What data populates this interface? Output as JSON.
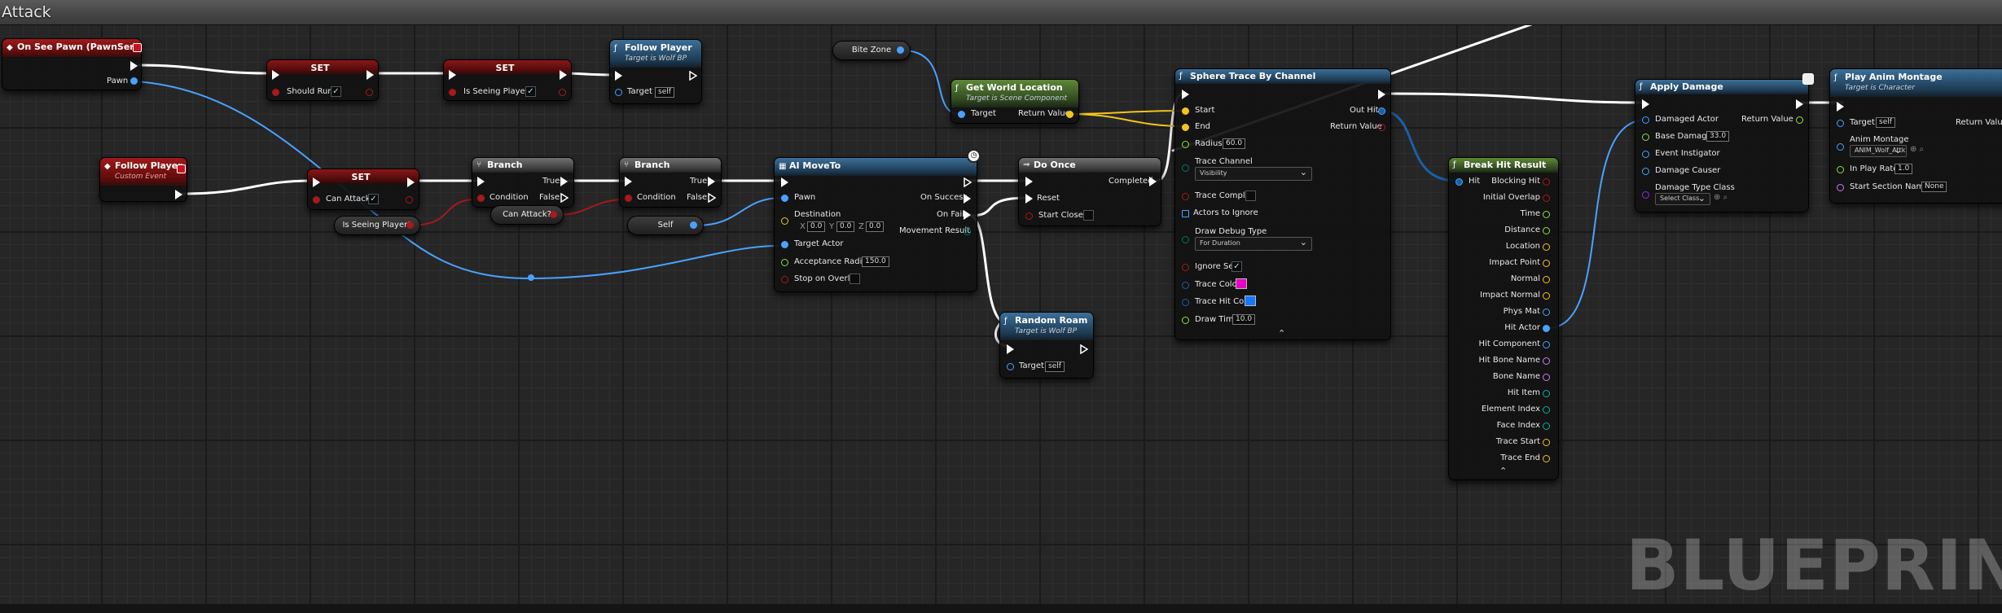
{
  "graph": {
    "title": "Attack",
    "watermark": "BLUEPRINT"
  },
  "colors": {
    "exec": "#ffffff",
    "object": "#4aa1ff",
    "bool": "#a51a1a",
    "float": "#8ce23c",
    "vector": "#f2c41f",
    "struct": "#1a5fa8",
    "byte": "#00756b",
    "name": "#c77ef3",
    "string": "#e55ad9"
  },
  "nodes": {
    "on_see_pawn": {
      "title": "On See Pawn (PawnSensing)",
      "pawn": "Pawn"
    },
    "set_should_run": {
      "title": "SET",
      "var": "Should Run?",
      "checked": "✓"
    },
    "set_is_seeing": {
      "title": "SET",
      "var": "Is Seeing Player?",
      "checked": "✓"
    },
    "follow_player_call": {
      "title": "Follow Player",
      "subtitle": "Target is Wolf BP",
      "target": "Target",
      "target_value": "self"
    },
    "follow_player_event": {
      "title": "Follow Player",
      "subtitle": "Custom Event"
    },
    "set_can_attack": {
      "title": "SET",
      "var": "Can Attack?",
      "checked": "✓"
    },
    "branch1": {
      "title": "Branch",
      "condition": "Condition",
      "true": "True",
      "false": "False"
    },
    "branch2": {
      "title": "Branch",
      "condition": "Condition",
      "true": "True",
      "false": "False"
    },
    "get_is_seeing": {
      "label": "Is Seeing Player?"
    },
    "get_can_attack": {
      "label": "Can Attack?"
    },
    "self_ref": {
      "label": "Self"
    },
    "bite_zone": {
      "label": "Bite Zone"
    },
    "get_world_location": {
      "title": "Get World Location",
      "subtitle": "Target is Scene Component",
      "target": "Target",
      "return": "Return Value"
    },
    "ai_move_to": {
      "title": "AI MoveTo",
      "pawn": "Pawn",
      "destination": "Destination",
      "x_lbl": "X",
      "x": "0.0",
      "y_lbl": "Y",
      "y": "0.0",
      "z_lbl": "Z",
      "z": "0.0",
      "target_actor": "Target Actor",
      "acceptance": "Acceptance Radius",
      "acceptance_value": "150.0",
      "stop_overlap": "Stop on Overlap",
      "on_success": "On Success",
      "on_fail": "On Fail",
      "move_result": "Movement Result"
    },
    "do_once": {
      "title": "Do Once",
      "completed": "Completed",
      "reset": "Reset",
      "start_closed": "Start Closed"
    },
    "random_roam": {
      "title": "Random Roam",
      "subtitle": "Target is Wolf BP",
      "target": "Target",
      "target_value": "self"
    },
    "sphere_trace": {
      "title": "Sphere Trace By Channel",
      "start": "Start",
      "end": "End",
      "radius": "Radius",
      "radius_value": "60.0",
      "trace_channel": "Trace Channel",
      "trace_channel_value": "Visibility",
      "trace_complex": "Trace Complex",
      "actors_ignore": "Actors to Ignore",
      "draw_debug": "Draw Debug Type",
      "draw_debug_value": "For Duration",
      "ignore_self": "Ignore Self",
      "ignore_self_checked": "✓",
      "trace_color": "Trace Color",
      "trace_color_value": "#e600c8",
      "trace_hit_color": "Trace Hit Color",
      "trace_hit_color_value": "#1478ff",
      "draw_time": "Draw Time",
      "draw_time_value": "10.0",
      "out_hit": "Out Hit",
      "return": "Return Value"
    },
    "break_hit": {
      "title": "Break Hit Result",
      "hit": "Hit",
      "outputs": [
        "Blocking Hit",
        "Initial Overlap",
        "Time",
        "Distance",
        "Location",
        "Impact Point",
        "Normal",
        "Impact Normal",
        "Phys Mat",
        "Hit Actor",
        "Hit Component",
        "Hit Bone Name",
        "Bone Name",
        "Hit Item",
        "Element Index",
        "Face Index",
        "Trace Start",
        "Trace End"
      ]
    },
    "apply_damage": {
      "title": "Apply Damage",
      "damaged_actor": "Damaged Actor",
      "base_damage": "Base Damage",
      "base_damage_value": "33.0",
      "event_instigator": "Event Instigator",
      "damage_causer": "Damage Causer",
      "damage_type": "Damage Type Class",
      "damage_type_value": "Select Class",
      "return": "Return Value"
    },
    "play_anim": {
      "title": "Play Anim Montage",
      "subtitle": "Target is Character",
      "target": "Target",
      "target_value": "self",
      "anim_montage": "Anim Montage",
      "anim_montage_value": "ANIM_Wolf_Attk",
      "play_rate": "In Play Rate",
      "play_rate_value": "1.0",
      "start_section": "Start Section Name",
      "start_section_value": "None",
      "return": "Return Value"
    }
  }
}
